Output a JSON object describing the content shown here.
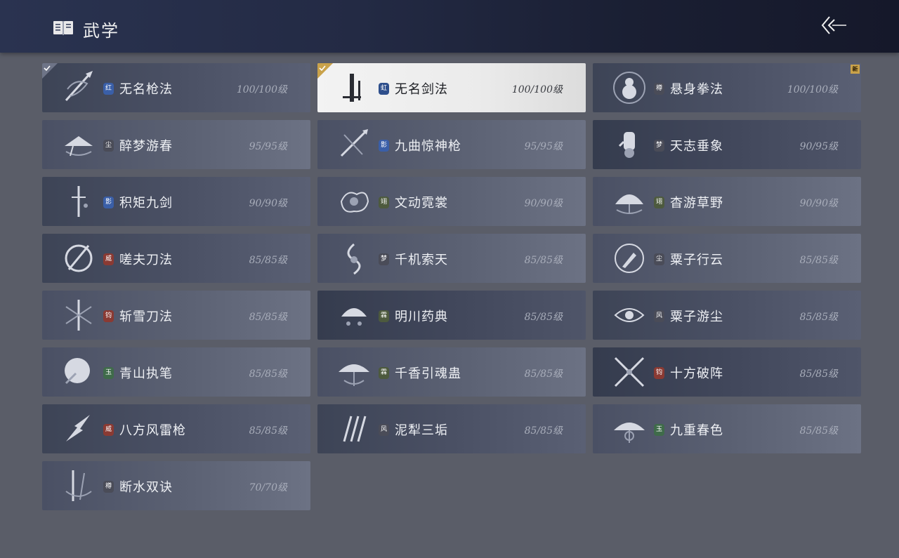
{
  "header": {
    "title": "武学"
  },
  "skills": [
    {
      "name": "无名枪法",
      "level": "100/100级",
      "badge": "红",
      "badge_color": "#3a5fa8",
      "selected": false,
      "checked": true,
      "new": false,
      "icon": "spear-swirl-icon",
      "variant": "v1"
    },
    {
      "name": "无名剑法",
      "level": "100/100级",
      "badge": "虹",
      "badge_color": "#2e4f8c",
      "selected": true,
      "checked": true,
      "new": false,
      "icon": "sword-stroke-icon",
      "variant": "v0"
    },
    {
      "name": "悬身拳法",
      "level": "100/100级",
      "badge": "樽",
      "badge_color": "#4a4c58",
      "selected": false,
      "checked": false,
      "new": true,
      "new_text": "新",
      "icon": "gourd-icon",
      "variant": "v1"
    },
    {
      "name": "醉梦游春",
      "level": "95/95级",
      "badge": "尘",
      "badge_color": "#4a4c58",
      "selected": false,
      "checked": false,
      "new": false,
      "icon": "hat-icon",
      "variant": "v2"
    },
    {
      "name": "九曲惊神枪",
      "level": "95/95级",
      "badge": "影",
      "badge_color": "#3a5fa8",
      "selected": false,
      "checked": false,
      "new": false,
      "icon": "crossed-spear-icon",
      "variant": "v2"
    },
    {
      "name": "天志垂象",
      "level": "90/95级",
      "badge": "梦",
      "badge_color": "#4a4c58",
      "selected": false,
      "checked": false,
      "new": false,
      "icon": "hand-icon",
      "variant": "v3"
    },
    {
      "name": "积矩九剑",
      "level": "90/90级",
      "badge": "影",
      "badge_color": "#3a5fa8",
      "selected": false,
      "checked": false,
      "new": false,
      "icon": "sword-vertical-icon",
      "variant": "v1"
    },
    {
      "name": "文动霓裳",
      "level": "90/90级",
      "badge": "翊",
      "badge_color": "#4d5a3e",
      "selected": false,
      "checked": false,
      "new": false,
      "icon": "cloud-swirl-icon",
      "variant": "v2"
    },
    {
      "name": "杳游草野",
      "level": "90/90级",
      "badge": "翊",
      "badge_color": "#4d5a3e",
      "selected": false,
      "checked": false,
      "new": false,
      "icon": "fan-icon",
      "variant": "v2"
    },
    {
      "name": "嗟夫刀法",
      "level": "85/85级",
      "badge": "威",
      "badge_color": "#8a3a33",
      "selected": false,
      "checked": false,
      "new": false,
      "icon": "blade-circle-icon",
      "variant": "v1"
    },
    {
      "name": "千机索天",
      "level": "85/85级",
      "badge": "梦",
      "badge_color": "#4a4c58",
      "selected": false,
      "checked": false,
      "new": false,
      "icon": "whip-icon",
      "variant": "v2"
    },
    {
      "name": "粟子行云",
      "level": "85/85级",
      "badge": "尘",
      "badge_color": "#4a4c58",
      "selected": false,
      "checked": false,
      "new": false,
      "icon": "brush-circle-icon",
      "variant": "v2"
    },
    {
      "name": "斩雪刀法",
      "level": "85/85级",
      "badge": "钧",
      "badge_color": "#8a3a33",
      "selected": false,
      "checked": false,
      "new": false,
      "icon": "snowflake-blade-icon",
      "variant": "v2"
    },
    {
      "name": "明川药典",
      "level": "85/85级",
      "badge": "霖",
      "badge_color": "#4d5a3e",
      "selected": false,
      "checked": false,
      "new": false,
      "icon": "medicine-fan-icon",
      "variant": "v3"
    },
    {
      "name": "粟子游尘",
      "level": "85/85级",
      "badge": "风",
      "badge_color": "#4a4c58",
      "selected": false,
      "checked": false,
      "new": false,
      "icon": "swirl-eye-icon",
      "variant": "v1"
    },
    {
      "name": "青山执笔",
      "level": "85/85级",
      "badge": "玉",
      "badge_color": "#3f6b4a",
      "selected": false,
      "checked": false,
      "new": false,
      "icon": "fan-round-icon",
      "variant": "v2"
    },
    {
      "name": "千香引魂蛊",
      "level": "85/85级",
      "badge": "霖",
      "badge_color": "#4d5a3e",
      "selected": false,
      "checked": false,
      "new": false,
      "icon": "umbrella-icon",
      "variant": "v2"
    },
    {
      "name": "十方破阵",
      "level": "85/85级",
      "badge": "钧",
      "badge_color": "#8a3a33",
      "selected": false,
      "checked": false,
      "new": false,
      "icon": "crossed-blades-icon",
      "variant": "v3"
    },
    {
      "name": "八方风雷枪",
      "level": "85/85级",
      "badge": "威",
      "badge_color": "#8a3a33",
      "selected": false,
      "checked": false,
      "new": false,
      "icon": "lightning-spear-icon",
      "variant": "v1"
    },
    {
      "name": "泥犁三垢",
      "level": "85/85级",
      "badge": "风",
      "badge_color": "#4a4c58",
      "selected": false,
      "checked": false,
      "new": false,
      "icon": "triple-slash-icon",
      "variant": "v1"
    },
    {
      "name": "九重春色",
      "level": "85/85级",
      "badge": "玉",
      "badge_color": "#3f6b4a",
      "selected": false,
      "checked": false,
      "new": false,
      "icon": "umbrella-ornate-icon",
      "variant": "v2"
    },
    {
      "name": "断水双诀",
      "level": "70/70级",
      "badge": "樽",
      "badge_color": "#4a4c58",
      "selected": false,
      "checked": false,
      "new": false,
      "icon": "twin-blade-icon",
      "variant": "v2"
    }
  ]
}
